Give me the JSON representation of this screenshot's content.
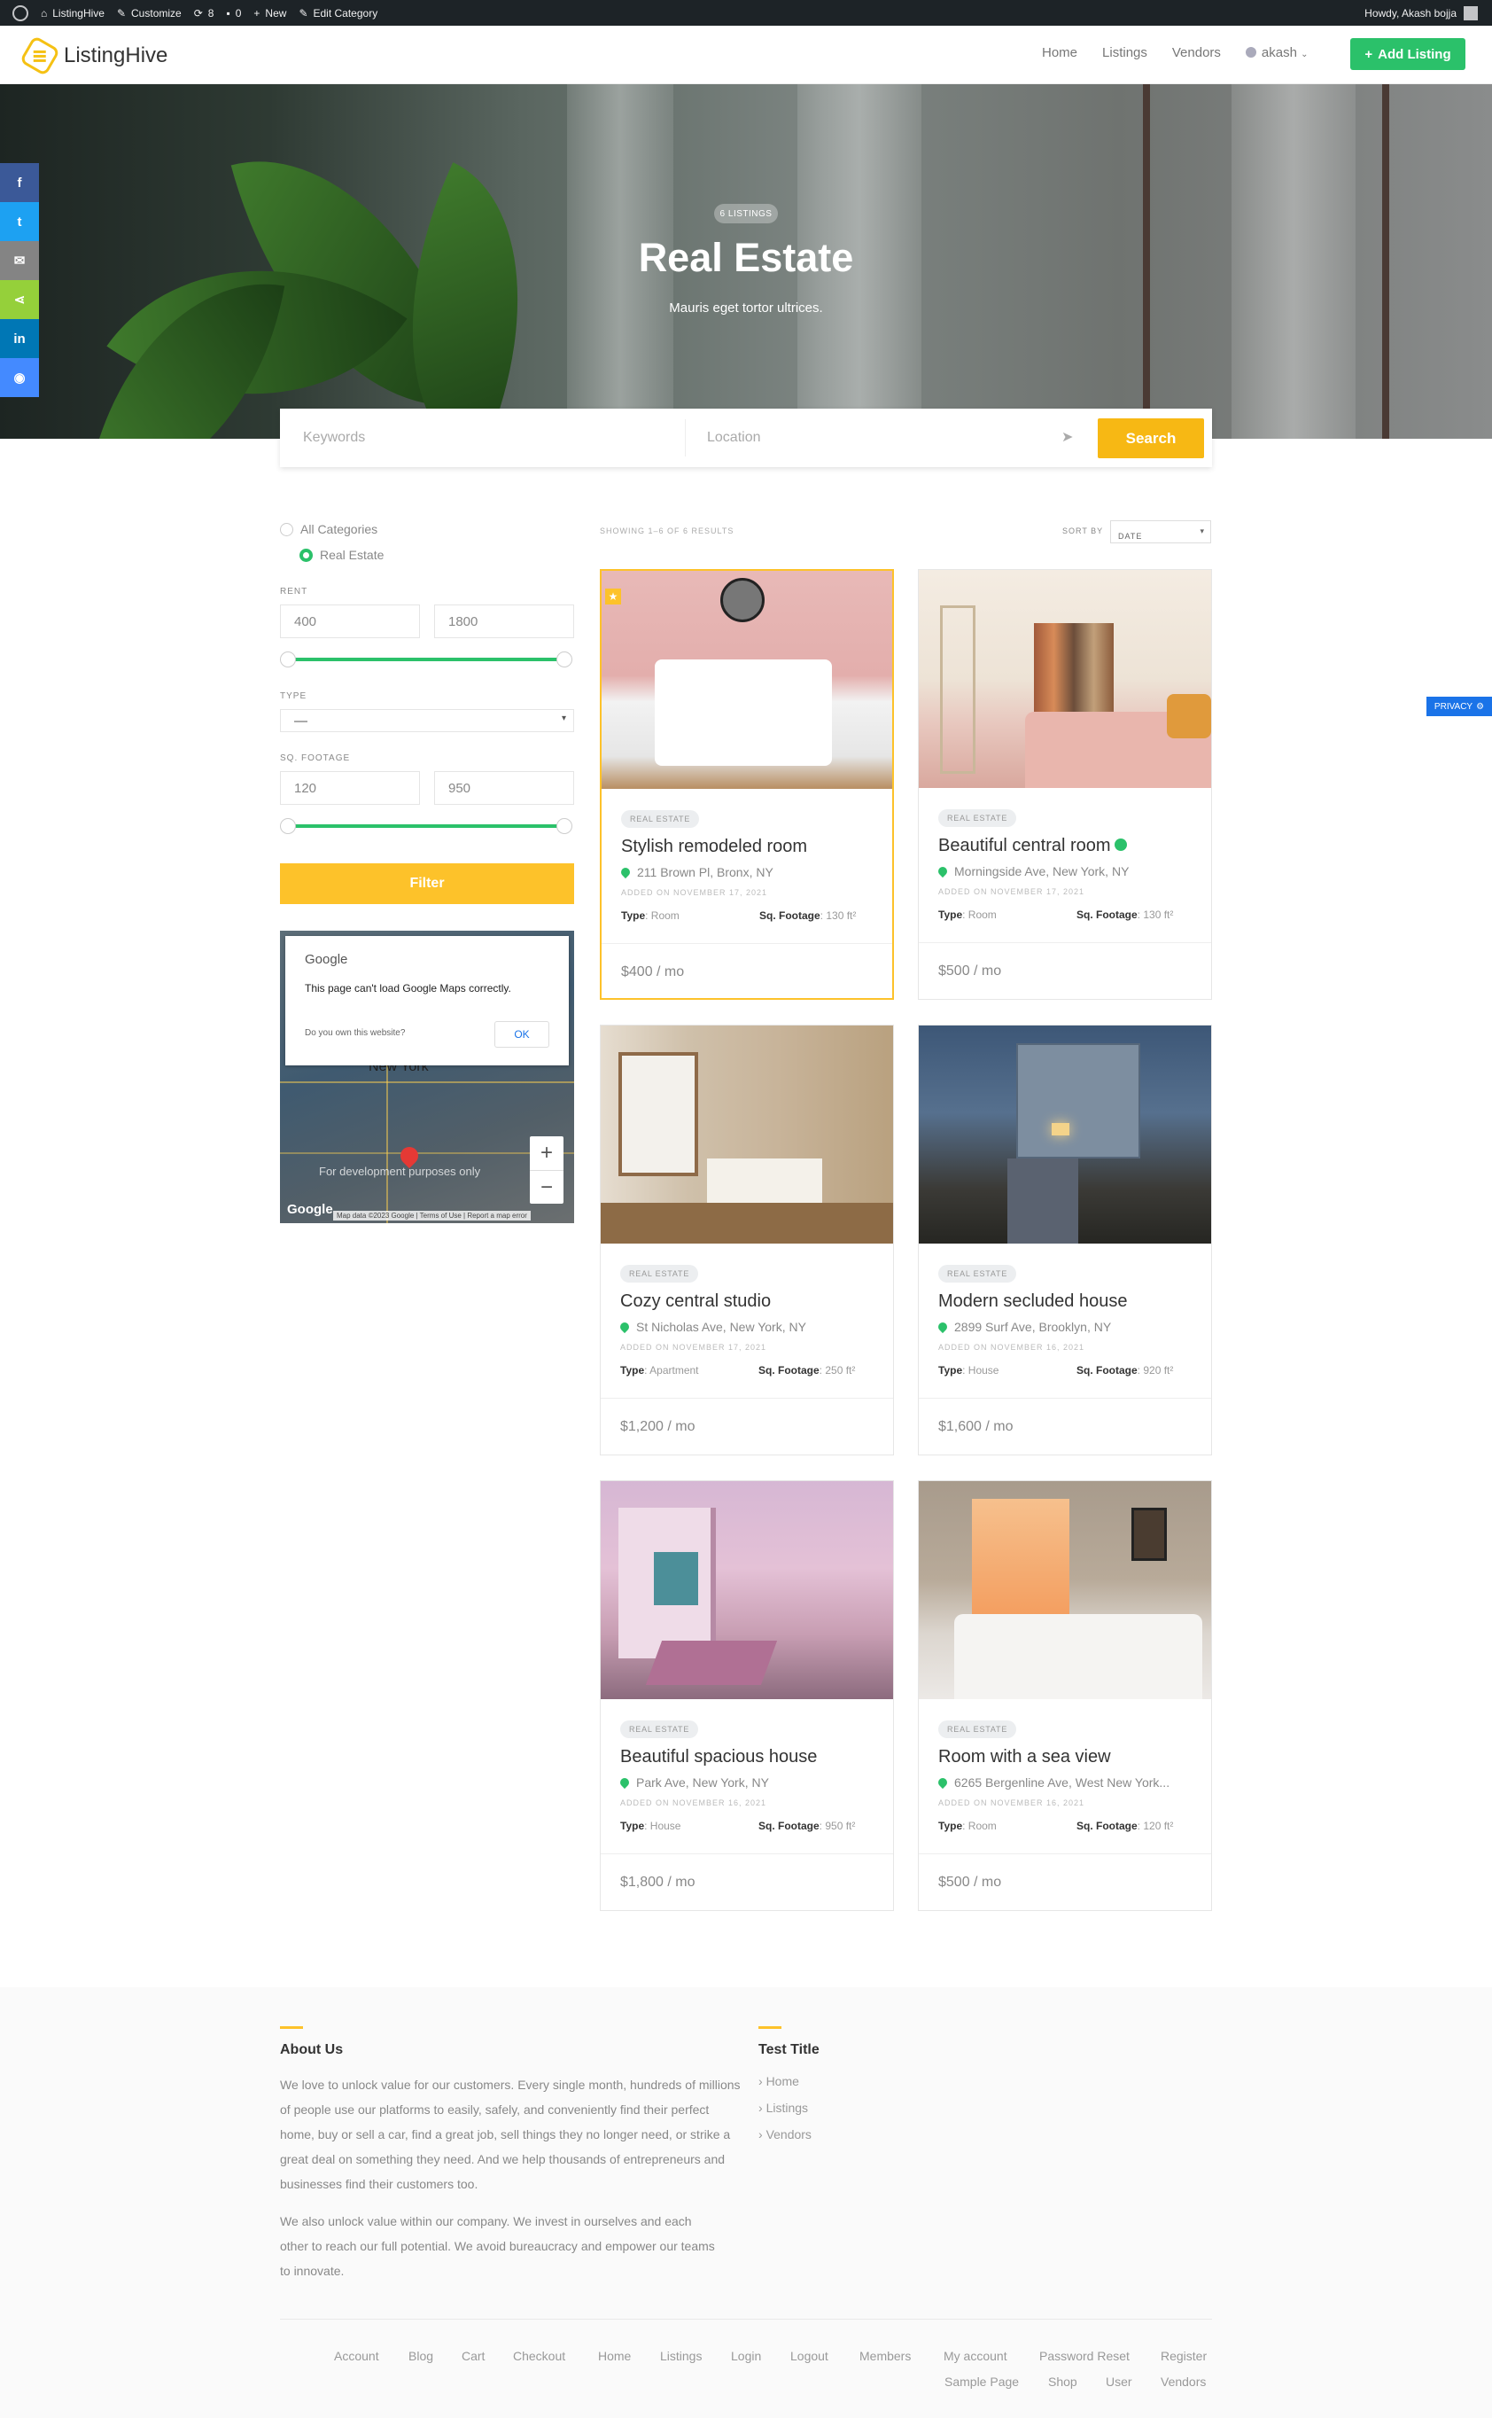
{
  "admin_bar": {
    "site_name": "ListingHive",
    "customize": "Customize",
    "updates": "8",
    "comments": "0",
    "new": "New",
    "edit_category": "Edit Category",
    "howdy": "Howdy, Akash bojja"
  },
  "header": {
    "logo": "ListingHive",
    "nav": [
      "Home",
      "Listings",
      "Vendors"
    ],
    "user": "akash",
    "add_listing": "Add Listing"
  },
  "hero": {
    "count": "6 LISTINGS",
    "title": "Real Estate",
    "subtitle": "Mauris eget tortor ultrices."
  },
  "search": {
    "keywords_placeholder": "Keywords",
    "location_placeholder": "Location",
    "button": "Search"
  },
  "sidebar": {
    "categories": [
      "All Categories",
      "Real Estate"
    ],
    "selected_category": "Real Estate",
    "rent_label": "RENT",
    "rent_min": "400",
    "rent_max": "1800",
    "type_label": "TYPE",
    "type_value": "—",
    "sqft_label": "SQ. FOOTAGE",
    "sqft_min": "120",
    "sqft_max": "950",
    "filter_button": "Filter"
  },
  "map": {
    "google": "Google",
    "error": "This page can't load Google Maps correctly.",
    "own_site": "Do you own this website?",
    "ok": "OK",
    "city": "New York",
    "dev_text": "For development purposes only",
    "zoom_in": "+",
    "zoom_out": "−",
    "attribution": "Map data ©2023 Google | Terms of Use | Report a map error"
  },
  "results": {
    "showing": "SHOWING 1–6 OF 6 RESULTS",
    "sort_label": "SORT BY",
    "sort_value": "DATE"
  },
  "listings": [
    {
      "category": "REAL ESTATE",
      "title": "Stylish remodeled room",
      "address": "211 Brown Pl, Bronx, NY",
      "added": "ADDED ON NOVEMBER 17, 2021",
      "type": "Room",
      "sqft": "130 ft²",
      "price": "$400 / mo"
    },
    {
      "category": "REAL ESTATE",
      "title": "Beautiful central room",
      "address": "Morningside Ave, New York, NY",
      "added": "ADDED ON NOVEMBER 17, 2021",
      "type": "Room",
      "sqft": "130 ft²",
      "price": "$500 / mo"
    },
    {
      "category": "REAL ESTATE",
      "title": "Cozy central studio",
      "address": "St Nicholas Ave, New York, NY",
      "added": "ADDED ON NOVEMBER 17, 2021",
      "type": "Apartment",
      "sqft": "250 ft²",
      "price": "$1,200 / mo"
    },
    {
      "category": "REAL ESTATE",
      "title": "Modern secluded house",
      "address": "2899 Surf Ave, Brooklyn, NY",
      "added": "ADDED ON NOVEMBER 16, 2021",
      "type": "House",
      "sqft": "920 ft²",
      "price": "$1,600 / mo"
    },
    {
      "category": "REAL ESTATE",
      "title": "Beautiful spacious house",
      "address": "Park Ave, New York, NY",
      "added": "ADDED ON NOVEMBER 16, 2021",
      "type": "House",
      "sqft": "950 ft²",
      "price": "$1,800 / mo"
    },
    {
      "category": "REAL ESTATE",
      "title": "Room with a sea view",
      "address": "6265 Bergenline Ave, West New York...",
      "added": "ADDED ON NOVEMBER 16, 2021",
      "type": "Room",
      "sqft": "120 ft²",
      "price": "$500 / mo"
    }
  ],
  "meta_labels": {
    "type": "Type",
    "sqft": "Sq. Footage"
  },
  "privacy": "PRIVACY",
  "footer": {
    "about_title": "About Us",
    "about_p1": "We love to unlock value for our customers. Every single month, hundreds of millions of people use our platforms to easily, safely, and conveniently find their perfect home, buy or sell a car, find a great job, sell things they no longer need, or strike a great deal on something they need. And we help thousands of entrepreneurs and businesses find their customers too.",
    "about_p2": "We also unlock value within our company. We invest in ourselves and each other to reach our full potential. We avoid bureaucracy and empower our teams to innovate.",
    "links_title": "Test Title",
    "links": [
      "Home",
      "Listings",
      "Vendors"
    ],
    "bottom_links": [
      "Account",
      "Blog",
      "Cart",
      "Checkout",
      "Home",
      "Listings",
      "Login",
      "Logout",
      "Members",
      "My account",
      "Password Reset",
      "Register",
      "Sample Page",
      "Shop",
      "User",
      "Vendors"
    ]
  },
  "colors": {
    "accent": "#fdc22a",
    "green": "#2bc16a",
    "adminbar": "#1d2327"
  },
  "share_icons": [
    "facebook-icon",
    "twitter-icon",
    "email-icon",
    "share-icon",
    "linkedin-icon",
    "messenger-icon"
  ]
}
